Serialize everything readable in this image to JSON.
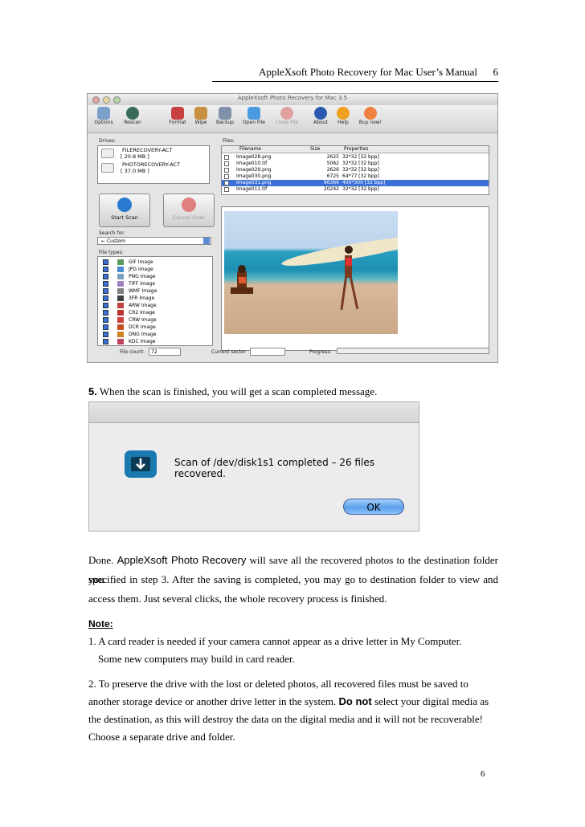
{
  "header": {
    "title": "AppleXsoft Photo Recovery for Mac User’s Manual",
    "page": "6"
  },
  "app": {
    "window_title": "AppleXsoft Photo Recovery for Mac 3.5",
    "toolbar": [
      "Options",
      "Rescan",
      "Format",
      "Wipe",
      "Backup",
      "Open File",
      "Close File",
      "About",
      "Help",
      "Buy now!"
    ],
    "drives_label": "Drives:",
    "drives": [
      {
        "name": "FILERECOVERY-ACT",
        "size": "[ 20.8 MB ]"
      },
      {
        "name": "PHOTORECOVERY-ACT",
        "size": "[ 37.0 MB ]"
      }
    ],
    "start_scan": "Start Scan",
    "cancel_scan": "Cancel Scan",
    "search_for_label": "Search for:",
    "search_for_value": "Custom",
    "file_types_label": "File types:",
    "file_types": [
      "GIF Image",
      "JPG Image",
      "PNG Image",
      "TIFF Image",
      "WMF Image",
      "3FR Image",
      "ARW Image",
      "CR2 Image",
      "CRW Image",
      "DCR Image",
      "DNG Image",
      "KDC Image"
    ],
    "files_label": "Files:",
    "columns": [
      "Filename",
      "Size",
      "Properties"
    ],
    "files": [
      {
        "name": "Image028.png",
        "size": "2625",
        "props": "32*32 [32 bpp]"
      },
      {
        "name": "Image010.tif",
        "size": "5062",
        "props": "32*32 [32 bpp]"
      },
      {
        "name": "Image029.png",
        "size": "2626",
        "props": "32*32 [32 bpp]"
      },
      {
        "name": "Image030.png",
        "size": "6725",
        "props": "64*77 [32 bpp]"
      },
      {
        "name": "Image031.png",
        "size": "96366",
        "props": "400*300 [32 bpp]"
      },
      {
        "name": "Image011.tif",
        "size": "20242",
        "props": "32*32 [32 bpp]"
      }
    ],
    "file_count_label": "File count:",
    "file_count": "72",
    "current_sector_label": "Current sector",
    "progress_label": "Progress:"
  },
  "step5": {
    "num": "5.",
    "text": " When the scan is finished, you will get a scan completed message."
  },
  "dialog": {
    "message": "Scan of /dev/disk1s1 completed – 26 files recovered.",
    "ok": "OK"
  },
  "done": {
    "pre": "Done. ",
    "product": "AppleXsoft Photo Recovery",
    "line1_rest": " will save all the recovered photos to the destination folder you",
    "line2": "specified in step 3. After the saving is completed, you may go to destination folder to view and",
    "line3": "access them. Just several clicks, the whole recovery process is finished."
  },
  "note": {
    "title": "Note:",
    "n1_line1": "1.  A card reader is needed if your camera cannot appear as a drive letter in My Computer.",
    "n1_line2": "Some new computers may build in card reader.",
    "n2_line1": "2. To preserve the drive with the lost or deleted photos, all recovered files must be saved to",
    "n2_line2_pre": "another storage device or another drive letter in the system. ",
    "n2_line2_bold": "Do not",
    "n2_line2_post": " select your digital media as",
    "n2_line3": "the destination, as this will destroy the data on the digital media and it will not be recoverable!",
    "n2_line4": "Choose a separate drive and folder."
  },
  "footer": {
    "page": "6"
  }
}
